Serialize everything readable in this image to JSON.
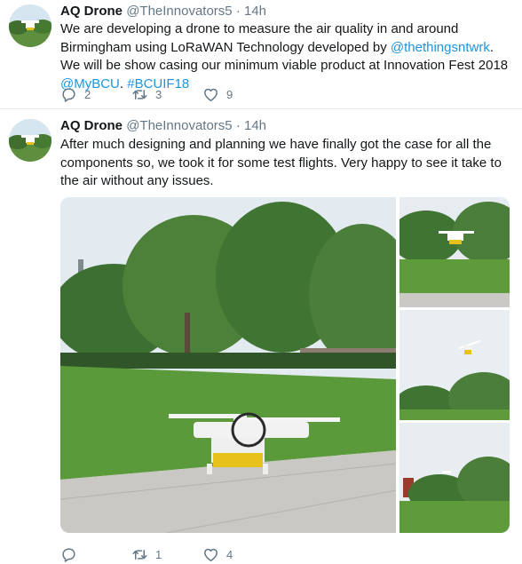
{
  "tweets": [
    {
      "author": "AQ Drone",
      "handle": "@TheInnovators5",
      "separator": "·",
      "time": "14h",
      "text_segments": [
        "We are developing a drone to measure the air quality in and around Birmingham using LoRaWAN Technology developed by ",
        "@thethingsntwrk",
        ". We will be show casing our minimum viable product at Innovation Fest 2018 ",
        "@MyBCU",
        ". ",
        "#BCUIF18"
      ],
      "replies": "2",
      "retweets": "3",
      "likes": "9"
    },
    {
      "author": "AQ Drone",
      "handle": "@TheInnovators5",
      "separator": "·",
      "time": "14h",
      "text": "After much designing and planning we have finally got the case for all the components so, we took it for some test flights. Very happy to see it take to the air without any issues.",
      "replies": "",
      "retweets": "1",
      "likes": "4"
    }
  ],
  "icons": {
    "reply": "reply-icon",
    "retweet": "retweet-icon",
    "like": "heart-icon"
  },
  "colors": {
    "link": "#1b95e0",
    "secondary_text": "#657786",
    "divider": "#e6ecf0"
  }
}
